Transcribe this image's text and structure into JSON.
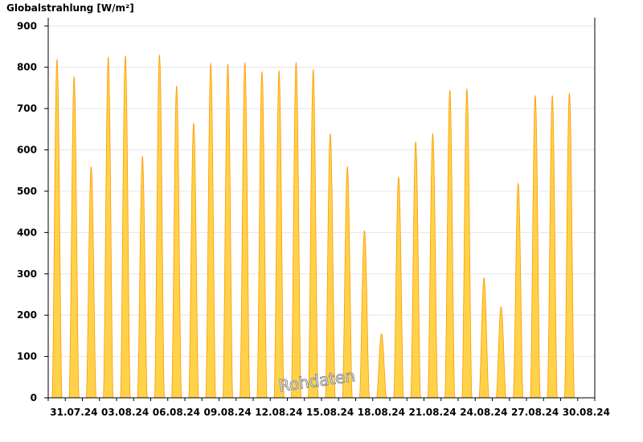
{
  "chart_data": {
    "type": "area",
    "title": "Globalstrahlung [W/m²]",
    "watermark": "Rohdaten",
    "ylim": [
      0,
      920
    ],
    "yticks": [
      0,
      100,
      200,
      300,
      400,
      500,
      600,
      700,
      800,
      900
    ],
    "x_range": [
      "2024-07-30",
      "2024-08-31"
    ],
    "xtick_labels": [
      "31.07.24",
      "03.08.24",
      "06.08.24",
      "09.08.24",
      "12.08.24",
      "15.08.24",
      "18.08.24",
      "21.08.24",
      "24.08.24",
      "27.08.24",
      "30.08.24"
    ],
    "grid": true,
    "colors": {
      "fill": "#ffd24a",
      "line": "#ff9900",
      "grid": "#e6e6e6",
      "axis": "#000000"
    },
    "series": [
      {
        "days": [
          "30.07.24",
          "31.07.24",
          "01.08.24",
          "02.08.24",
          "03.08.24",
          "04.08.24",
          "05.08.24",
          "06.08.24",
          "07.08.24",
          "08.08.24",
          "09.08.24",
          "10.08.24",
          "11.08.24",
          "12.08.24",
          "13.08.24",
          "14.08.24",
          "15.08.24",
          "16.08.24",
          "17.08.24",
          "18.08.24",
          "19.08.24",
          "20.08.24",
          "21.08.24",
          "22.08.24",
          "23.08.24",
          "24.08.24",
          "25.08.24",
          "26.08.24",
          "27.08.24",
          "28.08.24",
          "29.08.24",
          "30.08.24"
        ],
        "daily_peak": [
          820,
          778,
          560,
          825,
          828,
          585,
          830,
          755,
          665,
          810,
          808,
          812,
          790,
          792,
          812,
          795,
          640,
          560,
          405,
          155,
          535,
          620,
          640,
          745,
          748,
          290,
          220,
          520,
          732,
          732,
          738,
          0
        ]
      }
    ]
  }
}
